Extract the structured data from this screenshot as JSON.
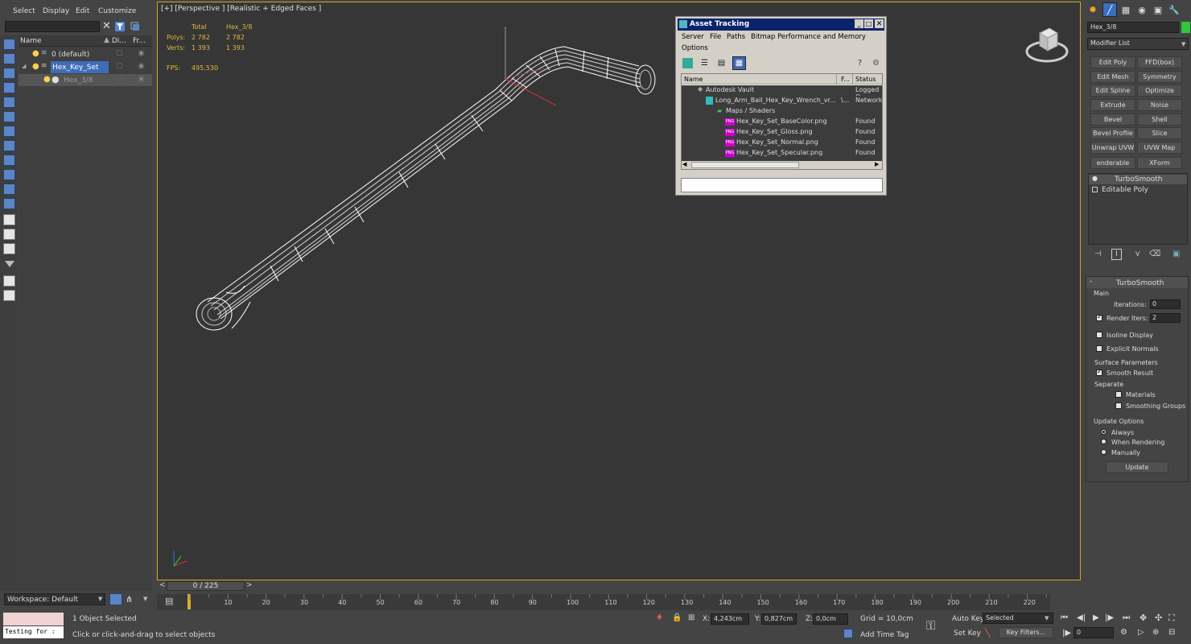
{
  "menus": [
    "Select",
    "Display",
    "Edit",
    "Customize"
  ],
  "explorer": {
    "columns": [
      "Name",
      "Di...",
      "Fr..."
    ],
    "rows": [
      {
        "label": "0 (default)"
      },
      {
        "label": "Hex_Key_Set"
      },
      {
        "label": "Hex_3/8"
      }
    ],
    "workspace": "Workspace: Default"
  },
  "viewport": {
    "label": "[+] [Perspective ] [Realistic + Edged Faces ]",
    "stats": {
      "total_h": "Total",
      "obj_h": "Hex_3/8",
      "polys_l": "Polys:",
      "polys_t": "2 782",
      "polys_o": "2 782",
      "verts_l": "Verts:",
      "verts_t": "1 393",
      "verts_o": "1 393",
      "fps_l": "FPS:",
      "fps_v": "495,530"
    }
  },
  "asset": {
    "title": "Asset Tracking",
    "menu": [
      "Server",
      "File",
      "Paths",
      "Bitmap Performance and Memory",
      "Options"
    ],
    "headers": {
      "name": "Name",
      "f": "F...",
      "status": "Status"
    },
    "rows": [
      {
        "name": "Autodesk Vault",
        "f": "",
        "status": "Logged O"
      },
      {
        "name": "Long_Arm_Ball_Hex_Key_Wrench_vr...",
        "f": "\\...",
        "status": "Network"
      },
      {
        "name": "Maps / Shaders",
        "f": "",
        "status": ""
      },
      {
        "name": "Hex_Key_Set_BaseColor.png",
        "f": "",
        "status": "Found"
      },
      {
        "name": "Hex_Key_Set_Gloss.png",
        "f": "",
        "status": "Found"
      },
      {
        "name": "Hex_Key_Set_Normal.png",
        "f": "",
        "status": "Found"
      },
      {
        "name": "Hex_Key_Set_Specular.png",
        "f": "",
        "status": "Found"
      }
    ],
    "png_badge": "PNG"
  },
  "cmd": {
    "object_name": "Hex_3/8",
    "modifier_list": "Modifier List",
    "buttons": [
      "Edit Poly",
      "FFD(box)",
      "Edit Mesh",
      "Symmetry",
      "Edit Spline",
      "Optimize",
      "Extrude",
      "Noise",
      "Bevel",
      "Shell",
      "Bevel Profile",
      "Slice",
      "Unwrap UVW",
      "UVW Map",
      "enderable Splin",
      "XForm"
    ],
    "stack": [
      "TurboSmooth",
      "Editable Poly"
    ],
    "rollout_title": "TurboSmooth",
    "main": "Main",
    "iterations_l": "Iterations:",
    "iterations_v": "0",
    "render_iters_l": "Render Iters:",
    "render_iters_v": "2",
    "isoline": "Isoline Display",
    "explicit": "Explicit Normals",
    "surface": "Surface Parameters",
    "smooth_result": "Smooth Result",
    "separate": "Separate",
    "materials": "Materials",
    "smoothing": "Smoothing Groups",
    "update_opts": "Update Options",
    "always": "Always",
    "when_render": "When Rendering",
    "manually": "Manually",
    "update_btn": "Update"
  },
  "timeline": {
    "frame": "0 / 225",
    "ticks": [
      "10",
      "20",
      "30",
      "40",
      "50",
      "60",
      "70",
      "80",
      "90",
      "100",
      "110",
      "120",
      "130",
      "140",
      "150",
      "160",
      "170",
      "180",
      "190",
      "200",
      "210",
      "220"
    ]
  },
  "status": {
    "script": "Testing for :",
    "selected": "1 Object Selected",
    "prompt": "Click or click-and-drag to select objects",
    "x_l": "X:",
    "x_v": "4,243cm",
    "y_l": "Y:",
    "y_v": "0,827cm",
    "z_l": "Z:",
    "z_v": "0,0cm",
    "grid": "Grid = 10,0cm",
    "add_time_tag": "Add Time Tag",
    "auto_key": "Auto Key",
    "set_key": "Set Key",
    "selected_dd": "Selected",
    "key_filters": "Key Filters...",
    "frame_v": "0"
  },
  "colors": {
    "viewport_border": "#d1a41f",
    "stat_text": "#e2b93b",
    "selection": "#3f6cb8"
  }
}
